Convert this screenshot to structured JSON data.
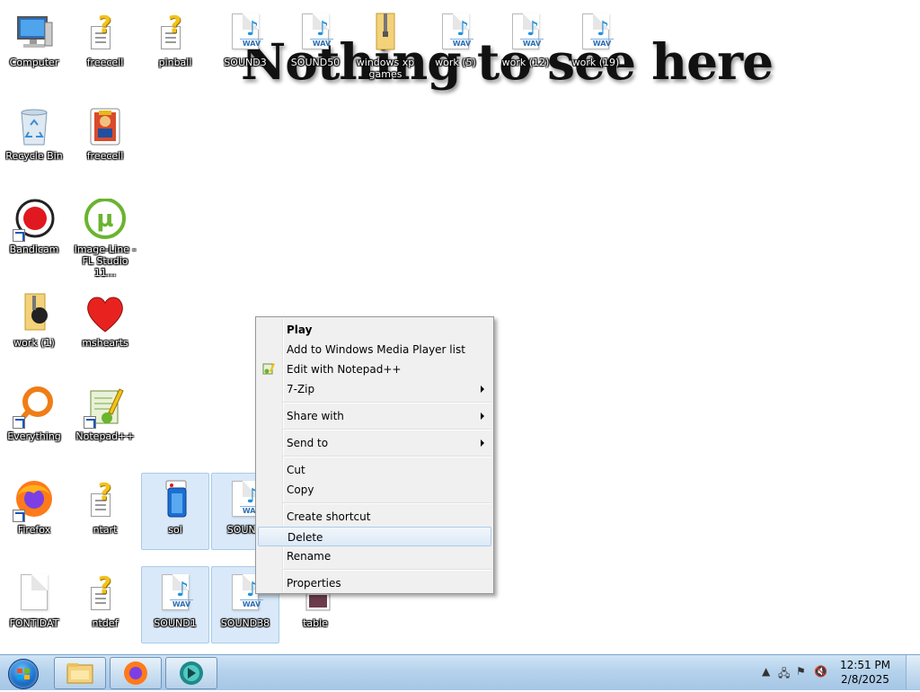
{
  "desktop": {
    "wallpaper_text": "Nothing to see here",
    "icons": {
      "computer": "Computer",
      "freecell1": "freecell",
      "pinball": "pinball",
      "sound3": "SOUND3",
      "sound50": "SOUND50",
      "winxp_games": "windows xp games",
      "work5": "work (5)",
      "work12": "work (12)",
      "work19": "work (19)",
      "recycle": "Recycle Bin",
      "freecell2": "freecell",
      "bandicam": "Bandicam",
      "flstudio": "Image-Line - FL Studio 11...",
      "work1": "work (1)",
      "mshearts": "mshearts",
      "everything": "Everything",
      "notepadpp": "Notepad++",
      "firefox": "Firefox",
      "ntart": "ntart",
      "sol": "sol",
      "sound_hidden": "SOUND",
      "fontidat": "FONTIDAT",
      "ntdef": "ntdef",
      "sound1": "SOUND1",
      "sound38": "SOUND38",
      "table": "table"
    },
    "wav_badge": "WAV"
  },
  "context_menu": {
    "play": "Play",
    "add_wmp": "Add to Windows Media Player list",
    "edit_npp": "Edit with Notepad++",
    "zip": "7-Zip",
    "share": "Share with",
    "sendto": "Send to",
    "cut": "Cut",
    "copy": "Copy",
    "shortcut": "Create shortcut",
    "delete": "Delete",
    "rename": "Rename",
    "properties": "Properties"
  },
  "taskbar": {
    "clock_time": "12:51 PM",
    "clock_date": "2/8/2025"
  },
  "colors": {
    "menu_highlight": "#dce9f7",
    "selection": "#a8cbe9",
    "taskbar": "#b5d2ec"
  }
}
